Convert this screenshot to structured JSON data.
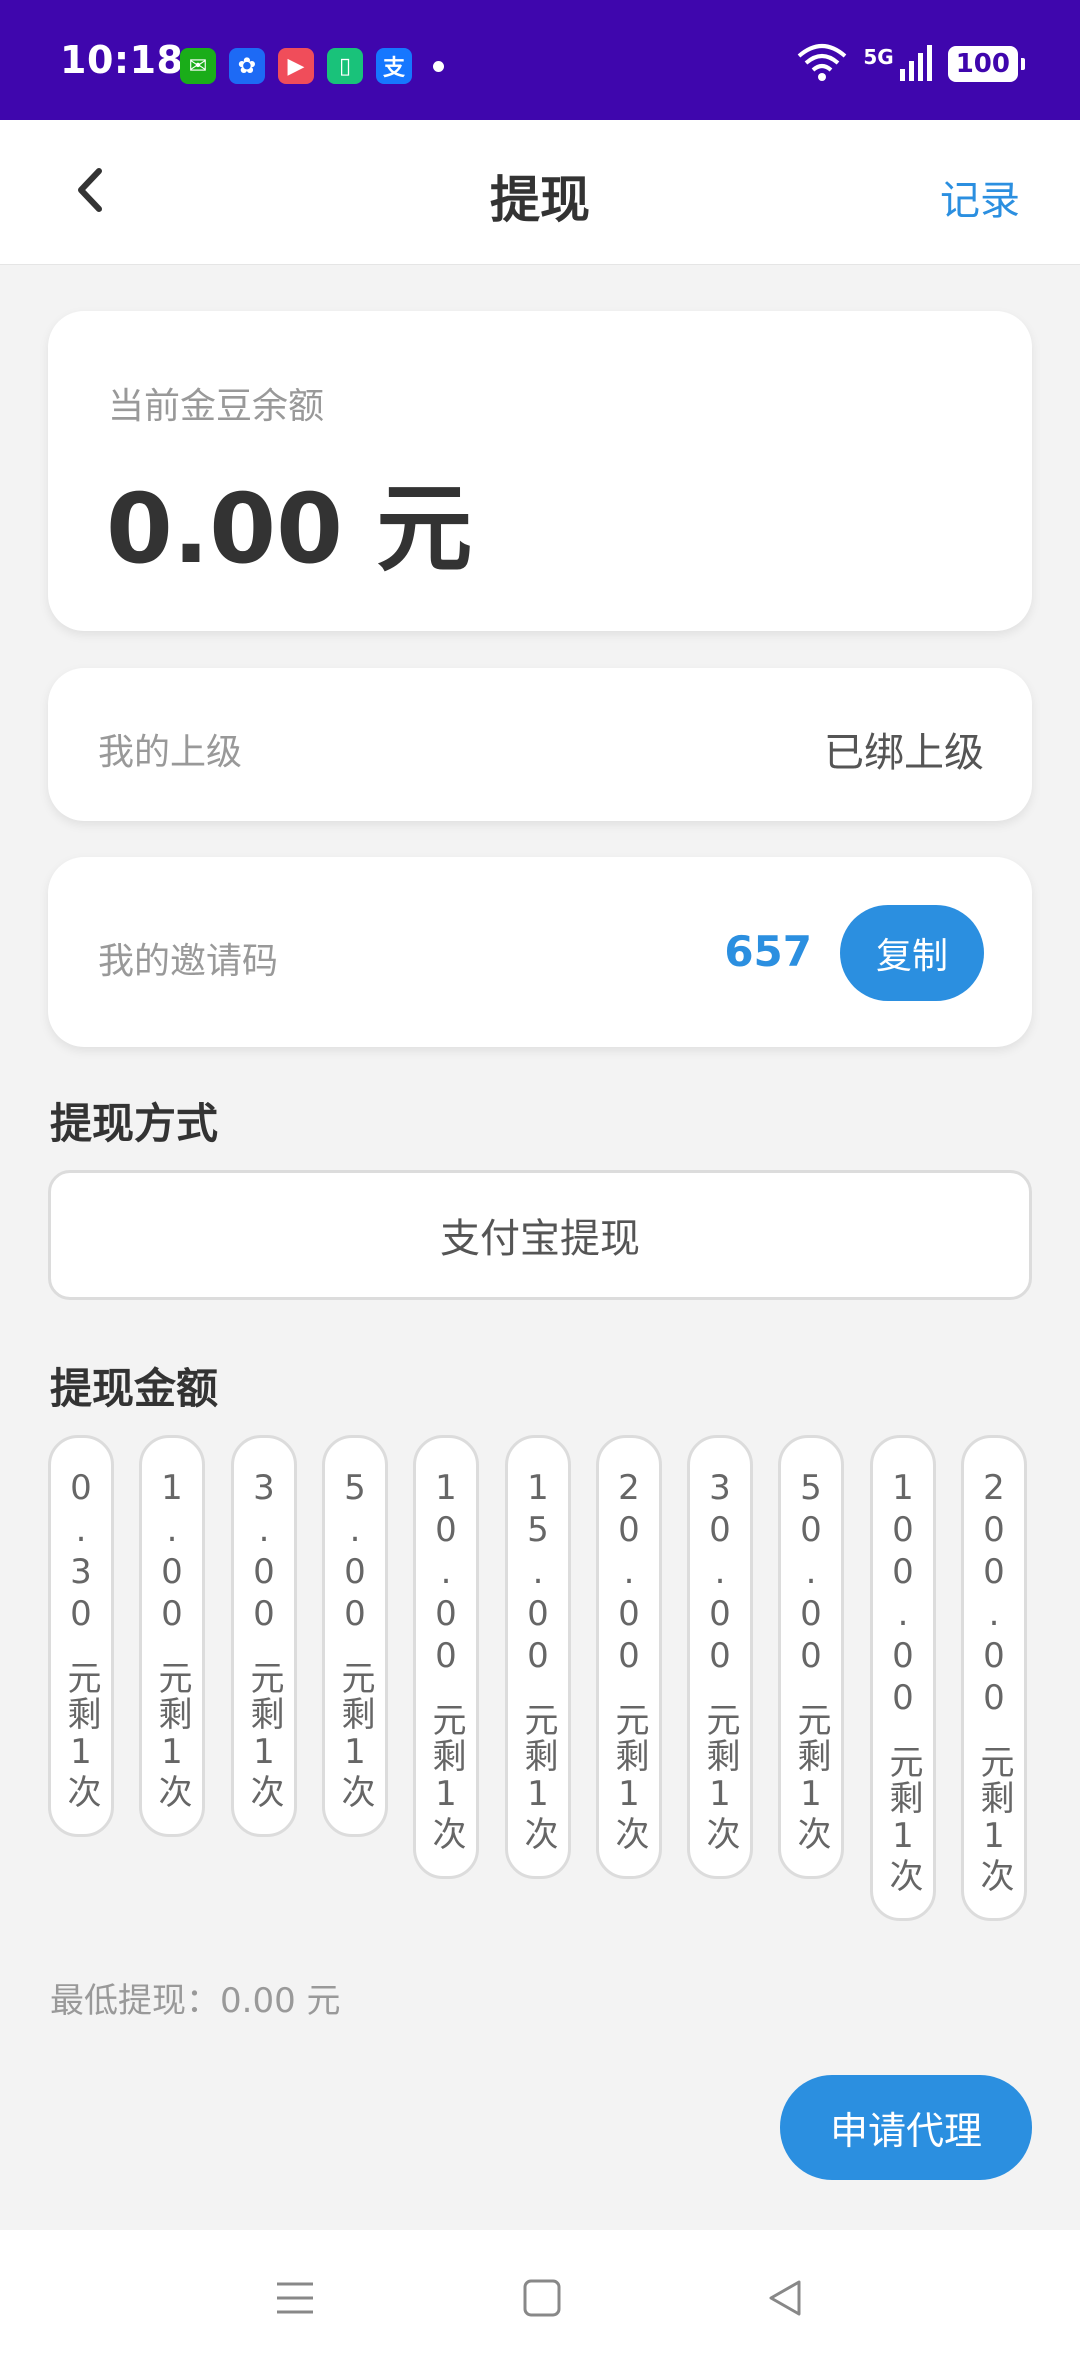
{
  "status_bar": {
    "time": "10:18",
    "network": "5G",
    "battery": "100",
    "apps": [
      {
        "name": "wechat-icon",
        "color": "#1aad19",
        "glyph": "✉"
      },
      {
        "name": "fan-app-icon",
        "color": "#1d6af5",
        "glyph": "✿"
      },
      {
        "name": "video-app-icon",
        "color": "#f04d5a",
        "glyph": "▶"
      },
      {
        "name": "green-app-icon",
        "color": "#19c27a",
        "glyph": "▯"
      },
      {
        "name": "alipay-icon",
        "color": "#1677ff",
        "glyph": "支"
      }
    ]
  },
  "nav": {
    "title": "提现",
    "record": "记录"
  },
  "balance": {
    "label": "当前金豆余额",
    "value": "0.00 元"
  },
  "superior": {
    "label": "我的上级",
    "value": "已绑上级"
  },
  "invite": {
    "label": "我的邀请码",
    "code": "657",
    "copy": "复制"
  },
  "method": {
    "title": "提现方式",
    "option": "支付宝提现"
  },
  "amount": {
    "title": "提现金额",
    "options": [
      {
        "value": "0.30",
        "desc": "元剩1次"
      },
      {
        "value": "1.00",
        "desc": "元剩1次"
      },
      {
        "value": "3.00",
        "desc": "元剩1次"
      },
      {
        "value": "5.00",
        "desc": "元剩1次"
      },
      {
        "value": "10.00",
        "desc": "元剩1次"
      },
      {
        "value": "15.00",
        "desc": "元剩1次"
      },
      {
        "value": "20.00",
        "desc": "元剩1次"
      },
      {
        "value": "30.00",
        "desc": "元剩1次"
      },
      {
        "value": "50.00",
        "desc": "元剩1次"
      },
      {
        "value": "100.00",
        "desc": "元剩1次"
      },
      {
        "value": "200.00",
        "desc": "元剩1次"
      }
    ]
  },
  "min_withdraw": "最低提现：0.00 元",
  "agent_button": "申请代理",
  "colors": {
    "status_bar": "#3f06ad",
    "accent": "#2b8fe0",
    "background": "#f3f3f3"
  }
}
